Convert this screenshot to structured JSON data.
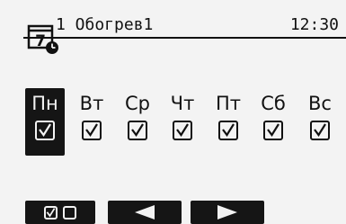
{
  "header": {
    "icon": "calendar-clock-icon",
    "icon_number": "7",
    "title": "1 Обогрев1",
    "time": "12:30"
  },
  "days": [
    {
      "label": "Пн",
      "checked": true,
      "selected": true
    },
    {
      "label": "Вт",
      "checked": true,
      "selected": false
    },
    {
      "label": "Ср",
      "checked": true,
      "selected": false
    },
    {
      "label": "Чт",
      "checked": true,
      "selected": false
    },
    {
      "label": "Пт",
      "checked": true,
      "selected": false
    },
    {
      "label": "Сб",
      "checked": true,
      "selected": false
    },
    {
      "label": "Вс",
      "checked": true,
      "selected": false
    }
  ],
  "buttons": {
    "toggle": "check-toggle-icon",
    "prev": "arrow-left-icon",
    "next": "arrow-right-icon"
  },
  "colors": {
    "background": "#f3f3f3",
    "foreground": "#111111",
    "highlight": "#151515"
  }
}
